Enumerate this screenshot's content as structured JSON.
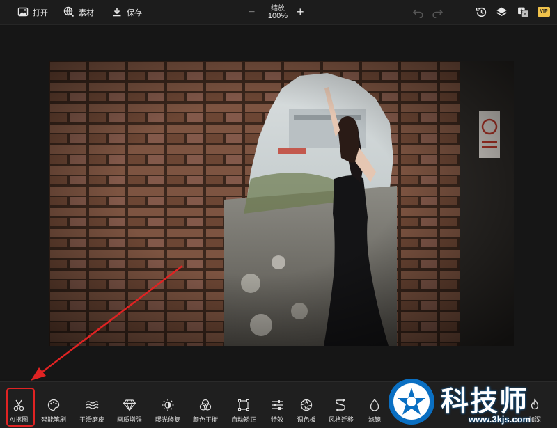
{
  "toolbar": {
    "open_label": "打开",
    "assets_label": "素材",
    "save_label": "保存",
    "zoom_label": "缩放",
    "zoom_value": "100%",
    "zoom_minus": "−",
    "zoom_plus": "+",
    "vip_label": "VIP"
  },
  "tools": [
    {
      "label": "AI抠图",
      "icon": "scissors-icon"
    },
    {
      "label": "智能笔刷",
      "icon": "palette-icon"
    },
    {
      "label": "平滑磨皮",
      "icon": "waves-icon"
    },
    {
      "label": "画质增强",
      "icon": "diamond-icon"
    },
    {
      "label": "曝光修复",
      "icon": "sun-icon"
    },
    {
      "label": "颜色平衡",
      "icon": "color-circles-icon"
    },
    {
      "label": "自动矫正",
      "icon": "crop-frame-icon"
    },
    {
      "label": "特效",
      "icon": "sliders-icon"
    },
    {
      "label": "调色板",
      "icon": "aperture-icon"
    },
    {
      "label": "风格迁移",
      "icon": "style-transfer-icon"
    },
    {
      "label": "滤镜",
      "icon": "drop-icon"
    },
    {
      "label": "加深",
      "icon": "flame-icon"
    }
  ],
  "watermark": {
    "text": "科技师",
    "url": "www.3kjs.com"
  },
  "colors": {
    "highlight": "#e02323",
    "arrow": "#e02323",
    "watermark_blue": "#0a6fc2"
  }
}
